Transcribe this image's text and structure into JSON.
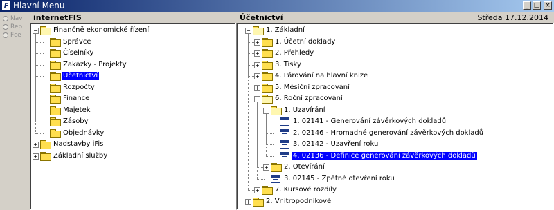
{
  "window": {
    "icon_text": "F",
    "title": "Hlavní Menu",
    "min_label": "_",
    "max_label": "□",
    "close_label": "×"
  },
  "rail": {
    "items": [
      {
        "label": "Nav"
      },
      {
        "label": "Rep"
      },
      {
        "label": "Fce"
      }
    ]
  },
  "left_panel": {
    "title": "internetFIS",
    "nodes": [
      {
        "label": "Finančně ekonomické řízení",
        "level": 0,
        "expanded": true
      },
      {
        "label": "Správce",
        "level": 1
      },
      {
        "label": "Číselníky",
        "level": 1
      },
      {
        "label": "Zakázky - Projekty",
        "level": 1
      },
      {
        "label": "Účetnictví",
        "level": 1,
        "selected": true
      },
      {
        "label": "Rozpočty",
        "level": 1
      },
      {
        "label": "Finance",
        "level": 1
      },
      {
        "label": "Majetek",
        "level": 1
      },
      {
        "label": "Zásoby",
        "level": 1
      },
      {
        "label": "Objednávky",
        "level": 1
      },
      {
        "label": "Nadstavby iFis",
        "level": 0,
        "expanded": false
      },
      {
        "label": "Základní služby",
        "level": 0,
        "expanded": false
      }
    ]
  },
  "right_panel": {
    "title": "Účetnictví",
    "date": "Středa  17.12.2014",
    "nodes": [
      {
        "label": "1.  Základní",
        "level": 0,
        "expanded": true
      },
      {
        "label": "1.  Účetní doklady",
        "level": 1,
        "expanded": false
      },
      {
        "label": "2.  Přehledy",
        "level": 1,
        "expanded": false
      },
      {
        "label": "3.  Tisky",
        "level": 1,
        "expanded": false
      },
      {
        "label": "4.  Párování na hlavní knize",
        "level": 1,
        "expanded": false
      },
      {
        "label": "5.  Měsíční zpracování",
        "level": 1,
        "expanded": false
      },
      {
        "label": "6.  Roční zpracování",
        "level": 1,
        "expanded": true
      },
      {
        "label": "1.  Uzavírání",
        "level": 2,
        "expanded": true
      },
      {
        "label": "1.  02141 - Generování závěrkových dokladů",
        "level": 3,
        "type": "report"
      },
      {
        "label": "2.  02146 - Hromadné generování závěrkových dokladů",
        "level": 3,
        "type": "report"
      },
      {
        "label": "3.  02142 - Uzavření roku",
        "level": 3,
        "type": "report"
      },
      {
        "label": "4.  02136 - Definice generování závěrkových dokladů",
        "level": 3,
        "type": "report",
        "selected": true
      },
      {
        "label": "2.  Otevírání",
        "level": 2,
        "expanded": false
      },
      {
        "label": "3.  02145 - Zpětné otevření roku",
        "level": 2,
        "type": "report"
      },
      {
        "label": "7.  Kursové rozdíly",
        "level": 1,
        "expanded": false
      },
      {
        "label": "2.  Vnitropodnikové",
        "level": 0,
        "expanded": false
      }
    ]
  }
}
